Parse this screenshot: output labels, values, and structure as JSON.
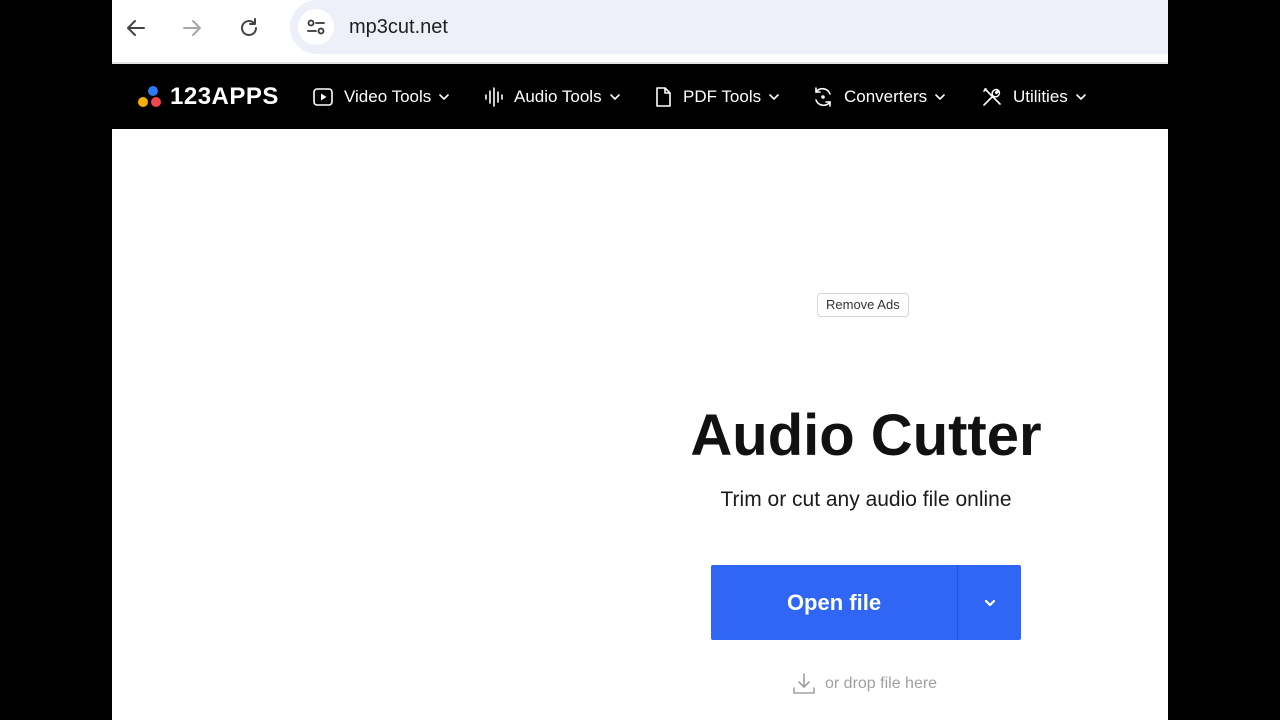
{
  "browser": {
    "url": "mp3cut.net"
  },
  "header": {
    "logo_text": "123APPS",
    "logo_colors": [
      "#2f7bf6",
      "#f6b100",
      "#f2454c"
    ],
    "menu": [
      {
        "label": "Video Tools",
        "icon": "play-icon"
      },
      {
        "label": "Audio Tools",
        "icon": "waveform-icon"
      },
      {
        "label": "PDF Tools",
        "icon": "document-icon"
      },
      {
        "label": "Converters",
        "icon": "convert-icon"
      },
      {
        "label": "Utilities",
        "icon": "tools-icon"
      }
    ]
  },
  "main": {
    "remove_ads": "Remove Ads",
    "title": "Audio Cutter",
    "subtitle": "Trim or cut any audio file online",
    "open_button": "Open file",
    "drop_hint": "or drop file here",
    "accent_color": "#2f66f6"
  }
}
